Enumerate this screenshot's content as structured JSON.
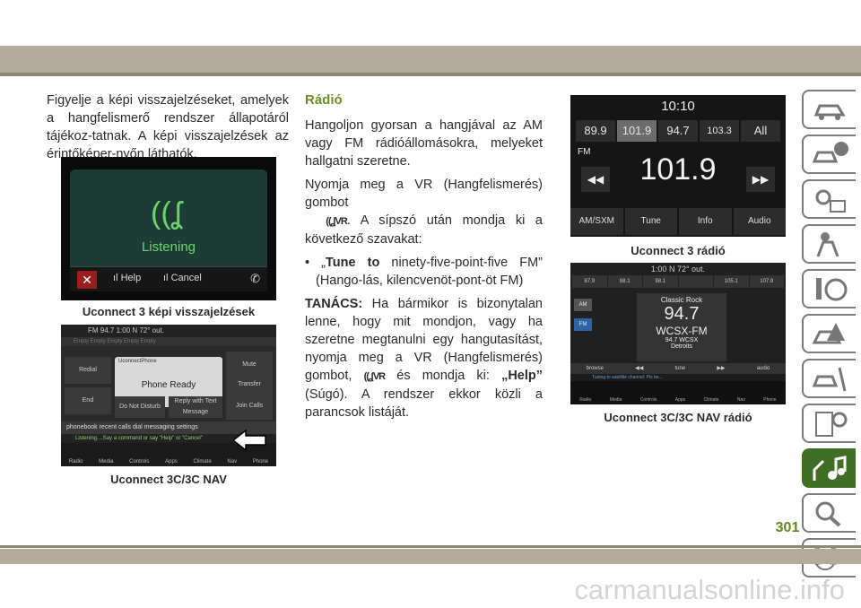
{
  "col1_text": "Figyelje a képi visszajelzéseket, amelyek a hangfelismerő rendszer állapotáról tájékoz-tatnak. A képi visszajelzések az érintőképer-nyőn láthatók.",
  "section_title": "Rádió",
  "p1": "Hangoljon gyorsan a hangjával az AM vagy FM rádióállomásokra, melyeket hallgatni szeretne.",
  "p2_a": "Nyomja meg a VR (Hangfelismerés) gombot",
  "p2_b": ". A sípszó után mondja ki a következő szavakat:",
  "bullet_lead": "• „",
  "bullet_bold": "Tune to",
  "bullet_rest": " ninety-five-point-five FM” (Hango-lás, kilencvenöt-pont-öt FM)",
  "tip_label": "TANÁCS:",
  "tip_text_a": " Ha bármikor is bizonytalan lenne, hogy mit mondjon, vagy ha szeretne megtanulni egy hangutasítást, nyomja meg a VR (Hangfelismerés) gombot,",
  "tip_text_b": " és mondja ki: ",
  "tip_help": "„Help”",
  "tip_text_c": " (Súgó). A rendszer ekkor közli a parancsok listáját.",
  "vr_glyph": "VR",
  "captions": {
    "c1": "Uconnect 3 képi visszajelzések",
    "c2": "Uconnect 3C/3C NAV",
    "c3": "Uconnect 3 rádió",
    "c4": "Uconnect 3C/3C NAV rádió"
  },
  "screen1": {
    "status": "Listening",
    "help": "Help",
    "cancel": "Cancel"
  },
  "screen2": {
    "header": "FM 94.7        1:00   N   72° out.",
    "presets": "Empty    Empty    Empty    Empty    Empty",
    "redial": "Redial",
    "end": "End",
    "mute": "Mute",
    "transfer": "Transfer",
    "join": "Join Calls",
    "phone_name": "UconnectPhone",
    "phone_ready": "Phone Ready",
    "dnd": "Do Not Disturb",
    "reply": "Reply with Text Message",
    "bar": "phonebook   recent calls   dial   messaging   settings",
    "listening": "Listening....Say a command or say \"Help\" or \"Cancel\"",
    "icons": [
      "Radio",
      "Media",
      "Controls",
      "Apps",
      "Climate",
      "Nav",
      "Phone"
    ]
  },
  "screen3": {
    "time": "10:10",
    "presets": [
      "89.9",
      "101.9",
      "94.7",
      "103.3",
      "All"
    ],
    "band": "FM",
    "freq": "101.9",
    "bottom": [
      "AM/SXM",
      "Tune",
      "Info",
      "Audio"
    ]
  },
  "screen4": {
    "time": "1:00   N   72° out.",
    "presets": [
      "87.9",
      "88.1",
      "98.1",
      "",
      "105.1",
      "107.9"
    ],
    "am": "AM",
    "fm": "FM",
    "station": "Classic Rock",
    "freq": "94.7",
    "call": "WCSX-FM",
    "sub": "94.7 WCSX",
    "city": "Detroits",
    "ctrls": [
      "browse",
      "◀◀",
      "tune",
      "▶▶",
      "audio"
    ],
    "tune_msg": "Tuning to satellite channel. Pls be...",
    "icons": [
      "Radio",
      "Media",
      "Controls",
      "Apps",
      "Climate",
      "Nav",
      "Phone"
    ]
  },
  "page_number": "301",
  "watermark": "carmanualsonline.info",
  "colors": {
    "accent": "#6a8f1e",
    "tab_active": "#3f6e24",
    "band": "#b2ab9b"
  }
}
